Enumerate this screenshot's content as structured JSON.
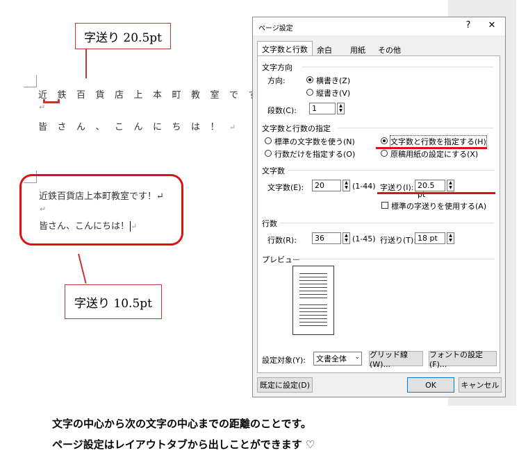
{
  "callouts": {
    "top": "字送り 20.5pt",
    "bottom": "字送り 10.5pt"
  },
  "sample_wide": {
    "line1": "近鉄百貨店上本町教室です！",
    "para_mark": "↵",
    "line2": "皆さん、こんにちは！",
    "line2_end": "↵"
  },
  "sample_normal": {
    "line1": "近鉄百貨店上本町教室です！↵",
    "line_blank": "↵",
    "line2": "皆さん、こんにちは！",
    "line2_end": "↵"
  },
  "dialog": {
    "title": "ページ設定",
    "help": "?",
    "close": "✕",
    "tabs": [
      "文字数と行数",
      "余白",
      "用紙",
      "その他"
    ],
    "direction": {
      "group": "文字方向",
      "label": "方向:",
      "horizontal": "横書き(Z)",
      "vertical": "縦書き(V)",
      "columns_label": "段数(C):",
      "columns_value": "1"
    },
    "grid": {
      "group": "文字数と行数の指定",
      "opt_standard": "標準の文字数を使う(N)",
      "opt_specify_both": "文字数と行数を指定する(H)",
      "opt_lines_only": "行数だけを指定する(O)",
      "opt_manuscript": "原稿用紙の設定にする(X)"
    },
    "chars": {
      "group": "文字数",
      "count_label": "文字数(E):",
      "count_value": "20",
      "count_range": "(1-44)",
      "pitch_label": "字送り(I):",
      "pitch_value": "20.5 pt",
      "use_standard": "標準の字送りを使用する(A)"
    },
    "lines": {
      "group": "行数",
      "count_label": "行数(R):",
      "count_value": "36",
      "count_range": "(1-45)",
      "pitch_label": "行送り(T):",
      "pitch_value": "18 pt"
    },
    "preview": {
      "group": "プレビュー"
    },
    "apply": {
      "label": "設定対象(Y):",
      "value": "文書全体",
      "grid_btn": "グリッド線(W)...",
      "font_btn": "フォントの設定(F)..."
    },
    "buttons": {
      "default": "既定に設定(D)",
      "ok": "OK",
      "cancel": "キャンセル"
    }
  },
  "footer": {
    "line1": "文字の中心から次の文字の中心までの距離のことです。",
    "line2": "ページ設定はレイアウトタブから出しことができます ♡"
  },
  "colors": {
    "accent_red": "#d11111",
    "ok_border": "#0078d7"
  }
}
